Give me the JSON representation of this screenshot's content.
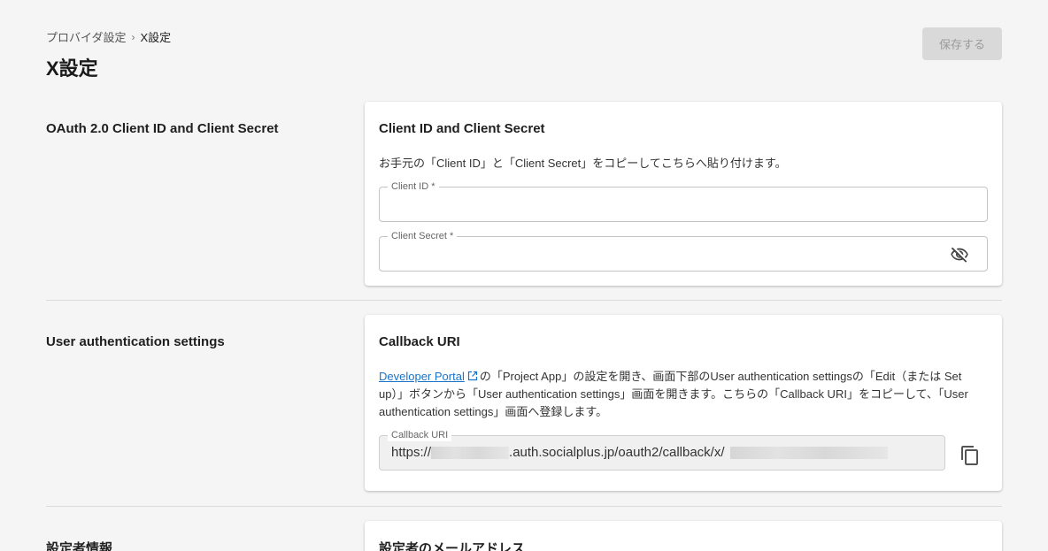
{
  "breadcrumb": {
    "parent": "プロバイダ設定",
    "separator": "›",
    "current": "X設定"
  },
  "page_title": "X設定",
  "save_label": "保存する",
  "sections": {
    "oauth": {
      "label": "OAuth 2.0 Client ID and Client Secret",
      "card_title": "Client ID and Client Secret",
      "description": "お手元の「Client ID」と「Client Secret」をコピーしてこちらへ貼り付けます。",
      "client_id": {
        "label": "Client ID *",
        "value": ""
      },
      "client_secret": {
        "label": "Client Secret *",
        "value": ""
      },
      "visibility_icon": "eye-off-icon"
    },
    "user_auth": {
      "label": "User authentication settings",
      "card_title": "Callback URI",
      "link_text": "Developer Portal",
      "description_rest": "の「Project App」の設定を開き、画面下部のUser authentication settingsの「Edit（または Set up）」ボタンから「User authentication settings」画面を開きます。こちらの「Callback URI」をコピーして、「User authentication settings」画面へ登録します。",
      "callback_label": "Callback URI",
      "callback_prefix": "https://",
      "callback_middle": ".auth.socialplus.jp/oauth2/callback/x/",
      "copy_icon": "copy-icon"
    },
    "setter": {
      "label": "設定者情報",
      "card_title": "設定者のメールアドレス"
    }
  },
  "colors": {
    "background": "#f5f5f5",
    "link": "#1a73c8",
    "disabled_button": "#d9d9d9"
  }
}
